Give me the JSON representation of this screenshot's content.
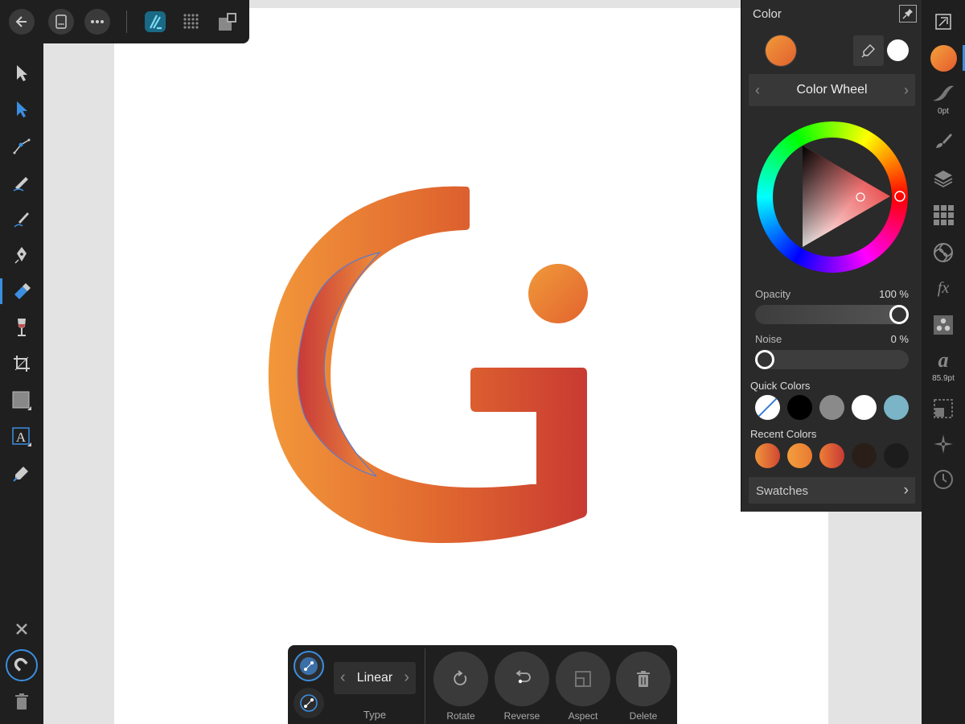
{
  "top_bar": {
    "icons": [
      "back-arrow-icon",
      "document-icon",
      "more-icon",
      "affinity-designer-persona-icon",
      "pixel-persona-icon",
      "export-persona-icon"
    ]
  },
  "left_tools": [
    "move-tool-icon",
    "node-tool-icon",
    "corner-tool-icon",
    "pencil-tool-icon",
    "vector-brush-tool-icon",
    "pen-tool-icon",
    "fill-tool-icon",
    "transparency-tool-icon",
    "crop-tool-icon",
    "shape-tool-icon",
    "artistic-text-tool-icon",
    "color-picker-tool-icon"
  ],
  "left_bottom": [
    "close-icon",
    "snapping-magnet-icon",
    "trash-icon"
  ],
  "color_panel": {
    "title": "Color",
    "mode": "Color Wheel",
    "opacity": {
      "label": "Opacity",
      "value": "100 %",
      "level": 1.0
    },
    "noise": {
      "label": "Noise",
      "value": "0 %",
      "level": 0.0
    },
    "quick_colors_label": "Quick Colors",
    "quick_colors": [
      "none",
      "#000000",
      "#8a8a8a",
      "#ffffff",
      "#7ab4c6"
    ],
    "recent_colors_label": "Recent Colors",
    "recent_colors": [
      "gradient-orange-red",
      "gradient-orange",
      "gradient-red",
      "#2a1e18",
      "#1c1c1c"
    ],
    "swatches_label": "Swatches",
    "primary_color": "#ea7a32",
    "secondary_color": "#ffffff"
  },
  "studio": {
    "stroke_width": "0pt",
    "font_size": "85.9pt",
    "icons": [
      "transform-icon",
      "color-icon",
      "stroke-icon",
      "brush-icon",
      "layers-icon",
      "swatches-grid-icon",
      "appearance-icon",
      "effects-icon",
      "styles-icon",
      "text-styles-icon",
      "snapping-icon",
      "navigator-icon",
      "history-icon"
    ]
  },
  "context": {
    "type_value": "Linear",
    "type_label": "Type",
    "actions": [
      {
        "label": "Rotate"
      },
      {
        "label": "Reverse"
      },
      {
        "label": "Aspect"
      },
      {
        "label": "Delete"
      }
    ]
  }
}
